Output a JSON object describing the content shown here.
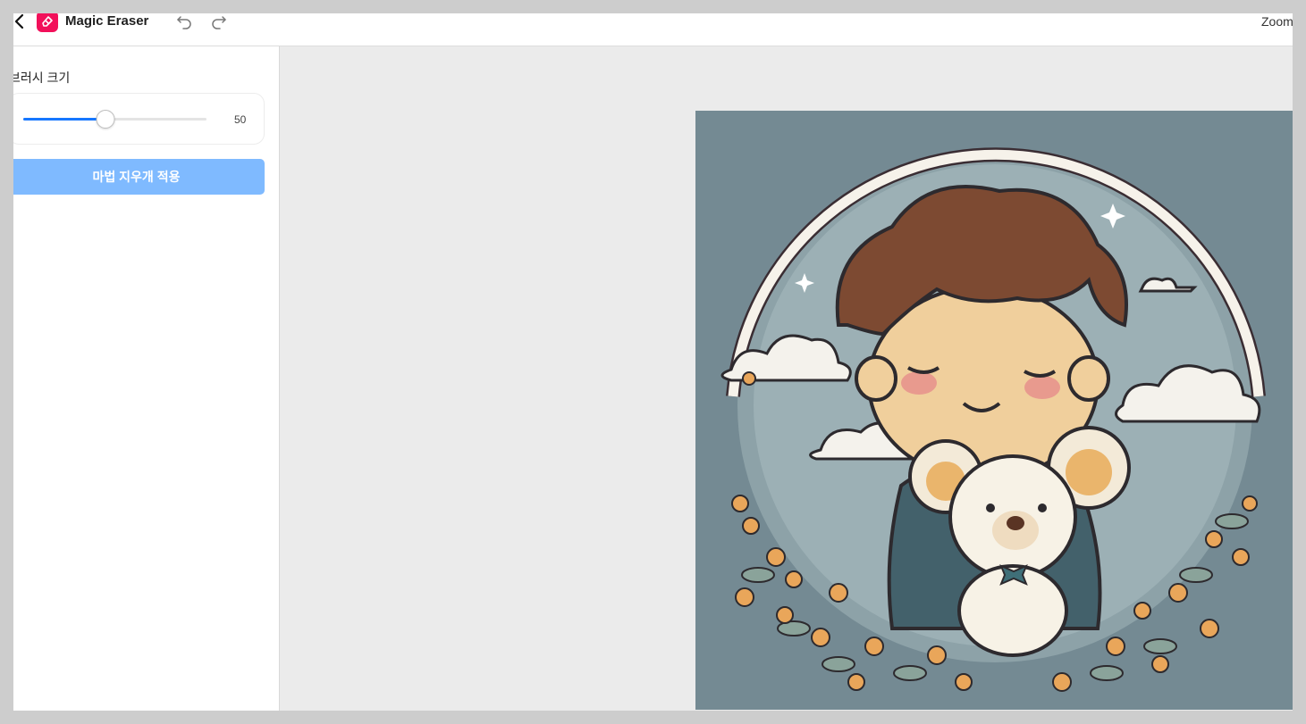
{
  "header": {
    "app_title": "Magic Eraser",
    "zoom_label": "Zoom",
    "icons": {
      "back": "chevron-left-icon",
      "app": "eraser-icon",
      "undo": "undo-icon",
      "redo": "redo-icon"
    },
    "accent_color": "#f2105a"
  },
  "sidebar": {
    "brush_size_label": "브러시 크기",
    "brush_size_value": "50",
    "slider_level": 0.45,
    "apply_button_label": "마법 지우개 적용",
    "button_color": "#7fbaff",
    "slider_color": "#1677ff"
  },
  "canvas": {
    "background": "#ebebeb",
    "image_background": "#748a93"
  }
}
